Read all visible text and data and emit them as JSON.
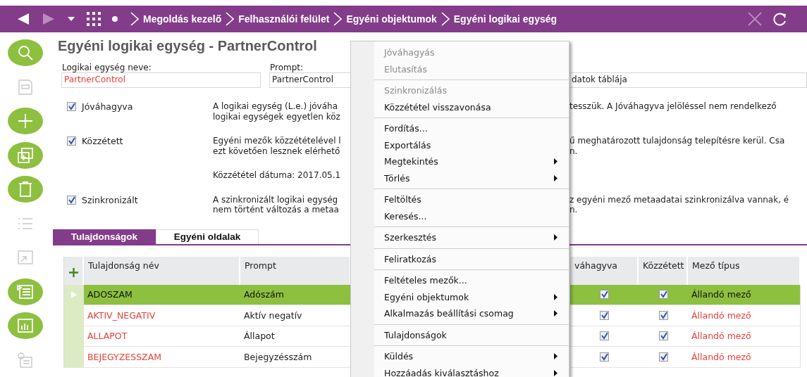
{
  "topbar": {
    "breadcrumbs": [
      "Megoldás kezelő",
      "Felhasználói felület",
      "Egyéni objektumok",
      "Egyéni logikai egység"
    ]
  },
  "sidebar": {
    "items": [
      {
        "kind": "search",
        "enabled": true
      },
      {
        "kind": "document",
        "enabled": false
      },
      {
        "kind": "add",
        "enabled": true
      },
      {
        "kind": "copy",
        "enabled": true
      },
      {
        "kind": "delete",
        "enabled": true
      },
      {
        "kind": "list",
        "enabled": false
      },
      {
        "kind": "export",
        "enabled": false
      },
      {
        "kind": "list-arrow",
        "enabled": true
      },
      {
        "kind": "chart",
        "enabled": true
      },
      {
        "kind": "info",
        "enabled": false
      }
    ]
  },
  "title": "Egyéni logikai egység - PartnerControl",
  "fields": {
    "name_label": "Logikai egység neve:",
    "name_value": "PartnerControl",
    "prompt_label": "Prompt:",
    "prompt_value": "PartnerControl",
    "column_3_value": "datok táblája"
  },
  "options": [
    {
      "label": "Jóváhagyva",
      "checked": true,
      "text_left": [
        "A logikai egység (L.e.) jóváha",
        "logikai egységek egyetlen köz"
      ],
      "text_right": [
        "tesszük. A Jóváhagyva jelöléssel nem rendelkező"
      ]
    },
    {
      "label": "Közzétett",
      "checked": true,
      "text_left": [
        "Egyéni mezők közzétételével l",
        "ezt követően lesznek elérhető"
      ],
      "text_right": [
        "ű meghatározott tulajdonság telepítésre kerül. Csa",
        "n."
      ],
      "date": "Közzététel dátuma: 2017.05.1"
    },
    {
      "label": "Szinkronizált",
      "checked": true,
      "text_left": [
        "A szinkronizált logikai egység",
        "nem történt változás a metaa"
      ],
      "text_right": [
        "z egyéni mező metaadatai szinkronizálva vannak, é",
        "n."
      ]
    }
  ],
  "tabs": [
    {
      "label": "Tulajdonságok",
      "selected": true
    },
    {
      "label": "Egyéni oldalak",
      "selected": false
    }
  ],
  "table": {
    "columns": [
      "Tulajdonság név",
      "Prompt",
      "váhagyva",
      "Közzétett",
      "Mező típus"
    ],
    "rows": [
      {
        "name": "ADOSZAM",
        "prompt": "Adószám",
        "column_3_checked": true,
        "published": true,
        "type": "Állandó mező",
        "selected": true,
        "flagged": false
      },
      {
        "name": "AKTIV_NEGATIV",
        "prompt": "Aktív negatív",
        "column_3_checked": true,
        "published": true,
        "type": "Állandó mező",
        "selected": false,
        "flagged": true
      },
      {
        "name": "ALLAPOT",
        "prompt": "Állapot",
        "column_3_checked": true,
        "published": true,
        "type": "Állandó mező",
        "selected": false,
        "flagged": true
      },
      {
        "name": "BEJEGYZESSZAM",
        "prompt": "Bejegyzésszám",
        "column_3_checked": true,
        "published": true,
        "type": "Állandó mező",
        "selected": false,
        "flagged": true
      }
    ]
  },
  "context_menu": {
    "sections": [
      [
        {
          "label": "Jóváhagyás",
          "disabled": true,
          "submenu": false
        },
        {
          "label": "Elutasítás",
          "disabled": true,
          "submenu": false
        }
      ],
      [
        {
          "label": "Szinkronizálás",
          "disabled": true,
          "submenu": false
        },
        {
          "label": "Közzététel visszavonása",
          "disabled": false,
          "submenu": false
        }
      ],
      [
        {
          "label": "Fordítás...",
          "disabled": false,
          "submenu": false
        },
        {
          "label": "Exportálás",
          "disabled": false,
          "submenu": false
        },
        {
          "label": "Megtekintés",
          "disabled": false,
          "submenu": true
        },
        {
          "label": "Törlés",
          "disabled": false,
          "submenu": true
        }
      ],
      [
        {
          "label": "Feltöltés",
          "disabled": false,
          "submenu": false
        },
        {
          "label": "Keresés...",
          "disabled": false,
          "submenu": false
        }
      ],
      [
        {
          "label": "Szerkesztés",
          "disabled": false,
          "submenu": true
        }
      ],
      [
        {
          "label": "Feliratkozás",
          "disabled": false,
          "submenu": false
        }
      ],
      [
        {
          "label": "Feltételes mezők...",
          "disabled": false,
          "submenu": false
        },
        {
          "label": "Egyéni objektumok",
          "disabled": false,
          "submenu": true
        },
        {
          "label": "Alkalmazás beállítási csomag",
          "disabled": false,
          "submenu": true
        }
      ],
      [
        {
          "label": "Tulajdonságok",
          "disabled": false,
          "submenu": false
        }
      ],
      [
        {
          "label": "Küldés",
          "disabled": false,
          "submenu": true
        },
        {
          "label": "Hozzáadás kiválasztáshoz",
          "disabled": false,
          "submenu": true
        }
      ]
    ]
  }
}
